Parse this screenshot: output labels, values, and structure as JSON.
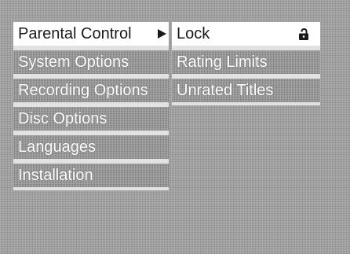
{
  "main_menu": {
    "items": [
      {
        "label": "Parental Control"
      },
      {
        "label": "System Options"
      },
      {
        "label": "Recording Options"
      },
      {
        "label": "Disc Options"
      },
      {
        "label": "Languages"
      },
      {
        "label": "Installation"
      }
    ]
  },
  "sub_menu": {
    "items": [
      {
        "label": "Lock"
      },
      {
        "label": "Rating Limits"
      },
      {
        "label": "Unrated Titles"
      }
    ]
  },
  "icons": {
    "submenu_arrow": "triangle-right-icon",
    "lock": "lock-icon"
  },
  "colors": {
    "selected_bg": "#ffffff",
    "selected_text": "#1a1a1a",
    "item_bg": "#8f8f8f",
    "item_text": "#ffffff"
  }
}
